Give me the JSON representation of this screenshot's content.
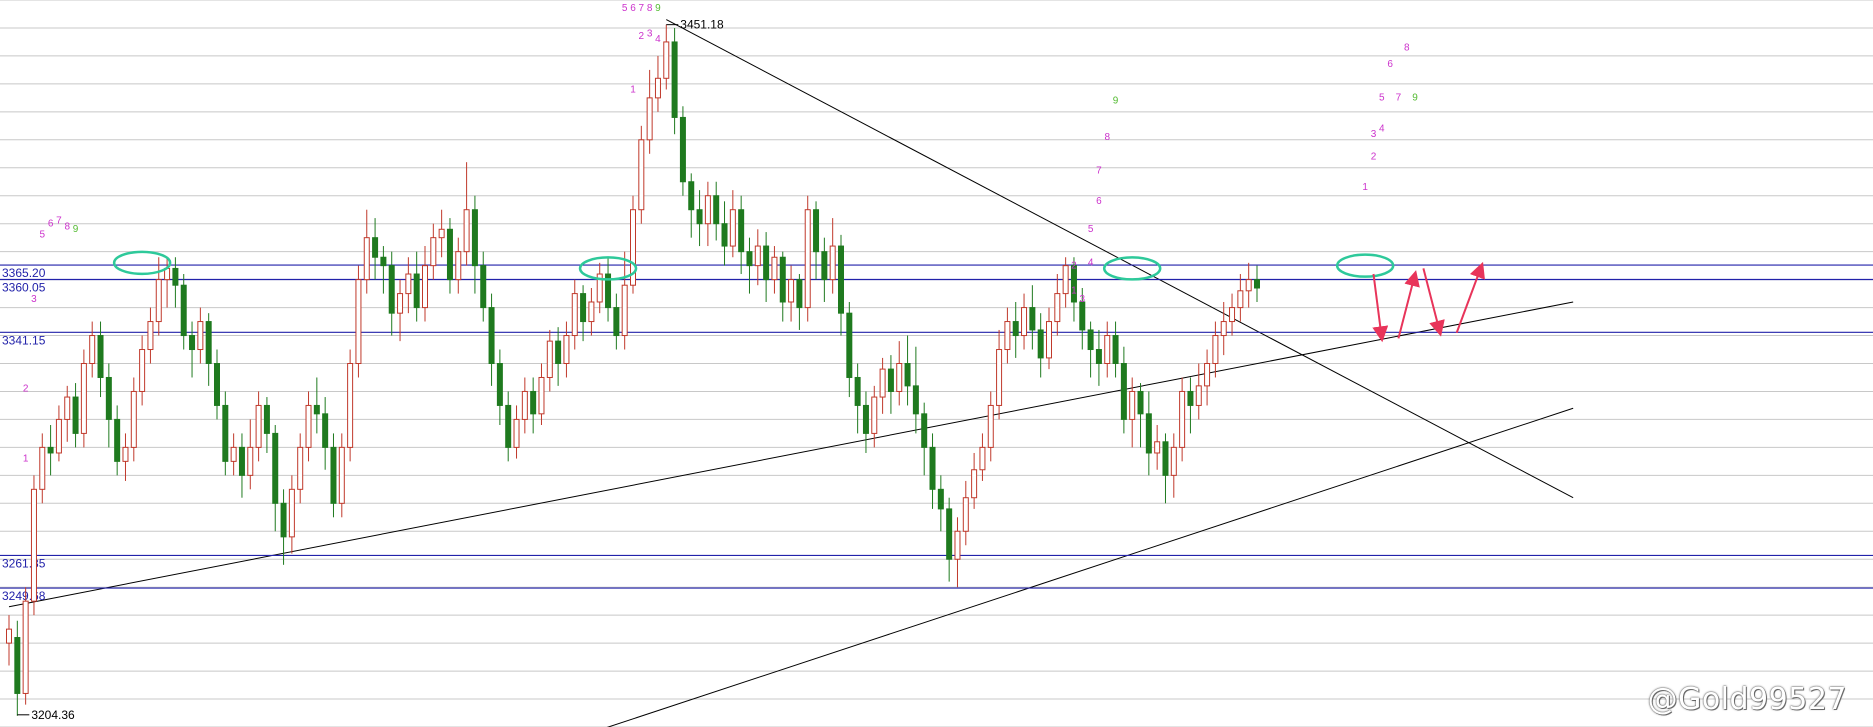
{
  "chart_data": {
    "type": "candlestick",
    "instrument_note": "",
    "y_axis": {
      "min": 3200,
      "max": 3460,
      "grid": true,
      "grid_step": 10
    },
    "horizontal_levels": [
      3365.2,
      3360.05,
      3341.15,
      3261.35,
      3249.68
    ],
    "level_labels": [
      "3365.20",
      "3360.05",
      "3341.15",
      "3261.35",
      "3249.68"
    ],
    "extremes": [
      {
        "label": "3451.18",
        "value": 3451.18,
        "bar": 79
      },
      {
        "label": "3204.36",
        "value": 3204.36,
        "bar": 1
      }
    ],
    "candles": [
      [
        3230,
        3235,
        3222,
        3240
      ],
      [
        3232,
        3212,
        3204,
        3238
      ],
      [
        3212,
        3245,
        3208,
        3250
      ],
      [
        3245,
        3285,
        3240,
        3290
      ],
      [
        3285,
        3300,
        3280,
        3305
      ],
      [
        3300,
        3298,
        3290,
        3308
      ],
      [
        3298,
        3310,
        3295,
        3315
      ],
      [
        3310,
        3318,
        3302,
        3322
      ],
      [
        3318,
        3305,
        3300,
        3323
      ],
      [
        3305,
        3330,
        3300,
        3335
      ],
      [
        3330,
        3340,
        3325,
        3345
      ],
      [
        3340,
        3325,
        3318,
        3345
      ],
      [
        3325,
        3310,
        3300,
        3330
      ],
      [
        3310,
        3295,
        3290,
        3315
      ],
      [
        3295,
        3300,
        3288,
        3305
      ],
      [
        3300,
        3320,
        3295,
        3325
      ],
      [
        3320,
        3335,
        3315,
        3340
      ],
      [
        3335,
        3345,
        3330,
        3350
      ],
      [
        3345,
        3360,
        3340,
        3368
      ],
      [
        3360,
        3364,
        3350,
        3368
      ],
      [
        3364,
        3358,
        3350,
        3368
      ],
      [
        3358,
        3340,
        3335,
        3362
      ],
      [
        3340,
        3335,
        3325,
        3345
      ],
      [
        3335,
        3345,
        3330,
        3350
      ],
      [
        3345,
        3330,
        3322,
        3348
      ],
      [
        3330,
        3315,
        3310,
        3335
      ],
      [
        3315,
        3295,
        3290,
        3320
      ],
      [
        3295,
        3300,
        3290,
        3305
      ],
      [
        3300,
        3290,
        3282,
        3305
      ],
      [
        3290,
        3300,
        3285,
        3310
      ],
      [
        3300,
        3315,
        3295,
        3320
      ],
      [
        3315,
        3305,
        3298,
        3318
      ],
      [
        3305,
        3280,
        3270,
        3308
      ],
      [
        3280,
        3268,
        3258,
        3285
      ],
      [
        3268,
        3285,
        3262,
        3290
      ],
      [
        3285,
        3300,
        3280,
        3305
      ],
      [
        3300,
        3315,
        3295,
        3320
      ],
      [
        3315,
        3312,
        3305,
        3325
      ],
      [
        3312,
        3300,
        3292,
        3318
      ],
      [
        3300,
        3280,
        3275,
        3305
      ],
      [
        3280,
        3300,
        3275,
        3305
      ],
      [
        3300,
        3330,
        3295,
        3335
      ],
      [
        3330,
        3360,
        3325,
        3365
      ],
      [
        3360,
        3375,
        3355,
        3385
      ],
      [
        3375,
        3368,
        3360,
        3382
      ],
      [
        3368,
        3365,
        3355,
        3372
      ],
      [
        3365,
        3348,
        3340,
        3370
      ],
      [
        3348,
        3355,
        3338,
        3360
      ],
      [
        3355,
        3362,
        3348,
        3368
      ],
      [
        3362,
        3350,
        3345,
        3370
      ],
      [
        3350,
        3365,
        3345,
        3372
      ],
      [
        3365,
        3375,
        3360,
        3380
      ],
      [
        3375,
        3378,
        3368,
        3385
      ],
      [
        3378,
        3360,
        3355,
        3382
      ],
      [
        3360,
        3370,
        3355,
        3375
      ],
      [
        3370,
        3385,
        3365,
        3402
      ],
      [
        3385,
        3365,
        3355,
        3390
      ],
      [
        3365,
        3350,
        3345,
        3370
      ],
      [
        3350,
        3330,
        3322,
        3355
      ],
      [
        3330,
        3315,
        3308,
        3335
      ],
      [
        3315,
        3300,
        3295,
        3320
      ],
      [
        3300,
        3310,
        3296,
        3315
      ],
      [
        3310,
        3320,
        3305,
        3325
      ],
      [
        3320,
        3312,
        3305,
        3325
      ],
      [
        3312,
        3325,
        3308,
        3330
      ],
      [
        3325,
        3338,
        3320,
        3342
      ],
      [
        3338,
        3330,
        3322,
        3343
      ],
      [
        3330,
        3340,
        3325,
        3345
      ],
      [
        3340,
        3355,
        3335,
        3360
      ],
      [
        3355,
        3345,
        3338,
        3358
      ],
      [
        3345,
        3352,
        3340,
        3357
      ],
      [
        3352,
        3362,
        3348,
        3366
      ],
      [
        3362,
        3350,
        3345,
        3368
      ],
      [
        3350,
        3340,
        3335,
        3355
      ],
      [
        3340,
        3358,
        3335,
        3370
      ],
      [
        3358,
        3385,
        3355,
        3390
      ],
      [
        3385,
        3410,
        3380,
        3415
      ],
      [
        3410,
        3425,
        3405,
        3435
      ],
      [
        3425,
        3432,
        3420,
        3440
      ],
      [
        3432,
        3445,
        3428,
        3451.18
      ],
      [
        3445,
        3418,
        3412,
        3450
      ],
      [
        3418,
        3395,
        3390,
        3422
      ],
      [
        3395,
        3385,
        3375,
        3398
      ],
      [
        3385,
        3380,
        3372,
        3392
      ],
      [
        3380,
        3390,
        3372,
        3395
      ],
      [
        3390,
        3380,
        3374,
        3395
      ],
      [
        3380,
        3372,
        3365,
        3388
      ],
      [
        3372,
        3385,
        3368,
        3392
      ],
      [
        3385,
        3370,
        3362,
        3390
      ],
      [
        3370,
        3365,
        3355,
        3375
      ],
      [
        3365,
        3372,
        3358,
        3378
      ],
      [
        3372,
        3360,
        3352,
        3377
      ],
      [
        3360,
        3368,
        3355,
        3372
      ],
      [
        3368,
        3352,
        3345,
        3370
      ],
      [
        3352,
        3360,
        3345,
        3365
      ],
      [
        3360,
        3350,
        3342,
        3362
      ],
      [
        3350,
        3385,
        3345,
        3390
      ],
      [
        3385,
        3370,
        3360,
        3388
      ],
      [
        3370,
        3360,
        3352,
        3375
      ],
      [
        3360,
        3372,
        3355,
        3382
      ],
      [
        3372,
        3348,
        3340,
        3376
      ],
      [
        3348,
        3325,
        3318,
        3352
      ],
      [
        3325,
        3315,
        3305,
        3330
      ],
      [
        3315,
        3305,
        3298,
        3320
      ],
      [
        3305,
        3318,
        3300,
        3322
      ],
      [
        3318,
        3328,
        3312,
        3332
      ],
      [
        3328,
        3320,
        3312,
        3333
      ],
      [
        3320,
        3330,
        3315,
        3338
      ],
      [
        3330,
        3322,
        3315,
        3340
      ],
      [
        3322,
        3312,
        3305,
        3336
      ],
      [
        3312,
        3300,
        3290,
        3316
      ],
      [
        3300,
        3285,
        3278,
        3305
      ],
      [
        3285,
        3278,
        3270,
        3290
      ],
      [
        3278,
        3260,
        3252,
        3282
      ],
      [
        3260,
        3270,
        3250,
        3275
      ],
      [
        3270,
        3282,
        3265,
        3288
      ],
      [
        3282,
        3292,
        3278,
        3298
      ],
      [
        3292,
        3300,
        3288,
        3305
      ],
      [
        3300,
        3315,
        3295,
        3320
      ],
      [
        3315,
        3335,
        3310,
        3342
      ],
      [
        3335,
        3345,
        3330,
        3350
      ],
      [
        3345,
        3340,
        3332,
        3352
      ],
      [
        3340,
        3350,
        3335,
        3355
      ],
      [
        3350,
        3342,
        3335,
        3358
      ],
      [
        3342,
        3332,
        3325,
        3348
      ],
      [
        3332,
        3345,
        3328,
        3350
      ],
      [
        3345,
        3355,
        3340,
        3362
      ],
      [
        3355,
        3365,
        3350,
        3368
      ],
      [
        3365,
        3352,
        3345,
        3368
      ],
      [
        3352,
        3342,
        3335,
        3357
      ],
      [
        3342,
        3335,
        3325,
        3345
      ],
      [
        3335,
        3330,
        3322,
        3342
      ],
      [
        3330,
        3340,
        3325,
        3345
      ],
      [
        3340,
        3330,
        3325,
        3345
      ],
      [
        3330,
        3310,
        3305,
        3336
      ],
      [
        3310,
        3320,
        3300,
        3325
      ],
      [
        3320,
        3312,
        3300,
        3323
      ],
      [
        3312,
        3298,
        3290,
        3320
      ],
      [
        3298,
        3302,
        3292,
        3308
      ],
      [
        3302,
        3290,
        3280,
        3305
      ],
      [
        3290,
        3300,
        3282,
        3305
      ],
      [
        3300,
        3320,
        3295,
        3325
      ],
      [
        3320,
        3315,
        3305,
        3325
      ],
      [
        3315,
        3322,
        3310,
        3330
      ],
      [
        3322,
        3330,
        3315,
        3335
      ],
      [
        3330,
        3340,
        3325,
        3345
      ],
      [
        3340,
        3345,
        3333,
        3352
      ],
      [
        3345,
        3350,
        3340,
        3355
      ],
      [
        3350,
        3356,
        3345,
        3362
      ],
      [
        3356,
        3360,
        3350,
        3366
      ],
      [
        3360,
        3357,
        3352,
        3365
      ]
    ],
    "count_labels": [
      {
        "t": "1",
        "bar": 2,
        "value": 3295,
        "c": "#cc33cc"
      },
      {
        "t": "2",
        "bar": 2,
        "value": 3320,
        "c": "#cc33cc"
      },
      {
        "t": "3",
        "bar": 3,
        "value": 3352,
        "c": "#cc33cc"
      },
      {
        "t": "5",
        "bar": 4,
        "value": 3375,
        "c": "#cc33cc"
      },
      {
        "t": "6",
        "bar": 5,
        "value": 3379,
        "c": "#cc33cc"
      },
      {
        "t": "7",
        "bar": 6,
        "value": 3380,
        "c": "#cc33cc"
      },
      {
        "t": "8",
        "bar": 7,
        "value": 3378,
        "c": "#cc33cc"
      },
      {
        "t": "9",
        "bar": 8,
        "value": 3377,
        "c": "#55bb33"
      },
      {
        "t": "1",
        "bar": 75,
        "value": 3427,
        "c": "#cc33cc"
      },
      {
        "t": "2",
        "bar": 76,
        "value": 3446,
        "c": "#cc33cc"
      },
      {
        "t": "3",
        "bar": 77,
        "value": 3447,
        "c": "#cc33cc"
      },
      {
        "t": "4",
        "bar": 78,
        "value": 3445,
        "c": "#cc33cc"
      },
      {
        "t": "5",
        "bar": 74,
        "value": 3456,
        "c": "#cc33cc"
      },
      {
        "t": "6",
        "bar": 75,
        "value": 3456,
        "c": "#cc33cc"
      },
      {
        "t": "7",
        "bar": 76,
        "value": 3456,
        "c": "#cc33cc"
      },
      {
        "t": "8",
        "bar": 77,
        "value": 3456,
        "c": "#cc33cc"
      },
      {
        "t": "9",
        "bar": 78,
        "value": 3456,
        "c": "#55bb33"
      },
      {
        "t": "1",
        "bar": 128,
        "value": 3355,
        "c": "#cc33cc"
      },
      {
        "t": "2",
        "bar": 128,
        "value": 3364,
        "c": "#cc33cc"
      },
      {
        "t": "3",
        "bar": 129,
        "value": 3352,
        "c": "#cc33cc"
      },
      {
        "t": "4",
        "bar": 130,
        "value": 3365,
        "c": "#cc33cc"
      },
      {
        "t": "5",
        "bar": 130,
        "value": 3377,
        "c": "#cc33cc"
      },
      {
        "t": "6",
        "bar": 131,
        "value": 3387,
        "c": "#cc33cc"
      },
      {
        "t": "7",
        "bar": 131,
        "value": 3398,
        "c": "#cc33cc"
      },
      {
        "t": "8",
        "bar": 132,
        "value": 3410,
        "c": "#cc33cc"
      },
      {
        "t": "9",
        "bar": 133,
        "value": 3423,
        "c": "#55bb33"
      },
      {
        "t": "1",
        "bar": 163,
        "value": 3392,
        "c": "#cc33cc"
      },
      {
        "t": "2",
        "bar": 164,
        "value": 3403,
        "c": "#cc33cc"
      },
      {
        "t": "3",
        "bar": 164,
        "value": 3411,
        "c": "#cc33cc"
      },
      {
        "t": "4",
        "bar": 165,
        "value": 3413,
        "c": "#cc33cc"
      },
      {
        "t": "5",
        "bar": 165,
        "value": 3424,
        "c": "#cc33cc"
      },
      {
        "t": "6",
        "bar": 166,
        "value": 3436,
        "c": "#cc33cc"
      },
      {
        "t": "7",
        "bar": 167,
        "value": 3424,
        "c": "#cc33cc"
      },
      {
        "t": "8",
        "bar": 168,
        "value": 3442,
        "c": "#cc33cc"
      },
      {
        "t": "9",
        "bar": 169,
        "value": 3424,
        "c": "#55bb33"
      }
    ],
    "trendlines": [
      {
        "from": [
          0,
          3243
        ],
        "to": [
          188,
          3352
        ],
        "color": "#000000"
      },
      {
        "from": [
          70,
          3198
        ],
        "to": [
          188,
          3314
        ],
        "color": "#000000"
      },
      {
        "from": [
          79,
          3453
        ],
        "to": [
          188,
          3282
        ],
        "color": "#000000"
      }
    ],
    "highlight_ellipses": [
      {
        "bar": 16,
        "value": 3366
      },
      {
        "bar": 72,
        "value": 3364
      },
      {
        "bar": 135,
        "value": 3364
      },
      {
        "bar": 163,
        "value": 3365
      }
    ],
    "projection_arrows": [
      {
        "from": [
          164,
          3362
        ],
        "to": [
          165,
          3339
        ]
      },
      {
        "from": [
          167,
          3339
        ],
        "to": [
          169,
          3362
        ]
      },
      {
        "from": [
          170,
          3364
        ],
        "to": [
          172,
          3341
        ]
      },
      {
        "from": [
          174,
          3341
        ],
        "to": [
          177,
          3365
        ]
      }
    ],
    "colors": {
      "up_candle": "#c0392b",
      "down_candle": "#1f7a1f",
      "level_line": "#2222aa",
      "grid": "#c8c8c8",
      "ellipse": "#2ec99a",
      "arrow": "#e8345a"
    },
    "watermark": "@Gold99527"
  }
}
